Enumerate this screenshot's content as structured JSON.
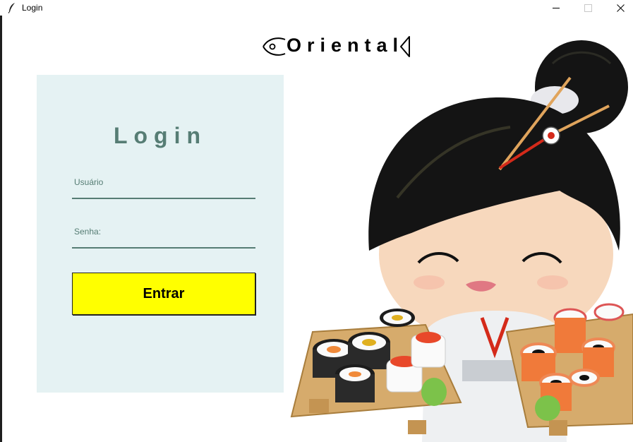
{
  "window": {
    "title": "Login",
    "app_icon": "feather-icon",
    "controls": [
      "minimize-icon",
      "maximize-icon",
      "close-icon"
    ]
  },
  "logo": {
    "text": "Oriental",
    "icon": "fish-icon"
  },
  "login": {
    "title": "Login",
    "username_placeholder": "Usuário",
    "password_placeholder": "Senha:",
    "submit_label": "Entrar"
  },
  "colors": {
    "panel_bg": "#e5f2f3",
    "accent": "#567d74",
    "button_bg": "#ffff00"
  },
  "illustration": {
    "subject": "geisha-with-sushi-illustration"
  }
}
